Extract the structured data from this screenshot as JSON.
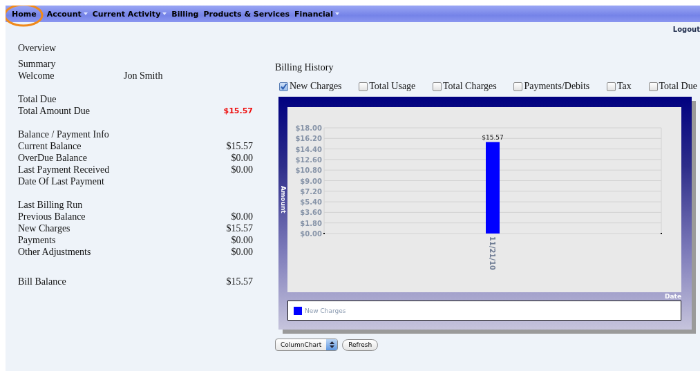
{
  "menu": [
    {
      "label": "Home",
      "has_dropdown": false,
      "highlighted": true
    },
    {
      "label": "Account",
      "has_dropdown": true,
      "highlighted": false
    },
    {
      "label": "Current Activity",
      "has_dropdown": true,
      "highlighted": false
    },
    {
      "label": "Billing",
      "has_dropdown": false,
      "highlighted": false
    },
    {
      "label": "Products & Services",
      "has_dropdown": false,
      "highlighted": false
    },
    {
      "label": "Financial",
      "has_dropdown": true,
      "highlighted": false
    }
  ],
  "logout": "Logout",
  "overview": {
    "title": "Overview",
    "sections": [
      {
        "title": "Summary",
        "rows": [
          {
            "label": "Welcome",
            "value": "Jon Smith",
            "kind": "name"
          }
        ]
      },
      {
        "title": "Total Due",
        "rows": [
          {
            "label": "Total Amount Due",
            "value": "$15.57",
            "kind": "alert"
          }
        ]
      },
      {
        "title": "Balance / Payment Info",
        "rows": [
          {
            "label": "Current Balance",
            "value": "$15.57",
            "kind": "amount"
          },
          {
            "label": "OverDue Balance",
            "value": "$0.00",
            "kind": "amount"
          },
          {
            "label": "Last Payment Received",
            "value": "$0.00",
            "kind": "amount"
          },
          {
            "label": "Date Of Last Payment"
          }
        ]
      },
      {
        "title": "Last Billing Run",
        "rows": [
          {
            "label": "Previous Balance",
            "value": "$0.00",
            "kind": "amount"
          },
          {
            "label": "New Charges",
            "value": "$15.57",
            "kind": "amount"
          },
          {
            "label": "Payments",
            "value": "$0.00",
            "kind": "amount"
          },
          {
            "label": "Other Adjustments",
            "value": "$0.00",
            "kind": "amount"
          }
        ]
      },
      {
        "rows": [
          {
            "label": "Bill Balance",
            "value": "$15.57",
            "kind": "amount"
          }
        ]
      }
    ]
  },
  "billing_history": {
    "title": "Billing History",
    "options": [
      {
        "label": "New Charges",
        "checked": true
      },
      {
        "label": "Total Usage",
        "checked": false
      },
      {
        "label": "Total Charges",
        "checked": false
      },
      {
        "label": "Payments/Debits",
        "checked": false
      },
      {
        "label": "Tax",
        "checked": false
      },
      {
        "label": "Total Due",
        "checked": false
      }
    ],
    "chart_data": {
      "type": "bar",
      "xlabel": "Date",
      "ylabel": "Amount",
      "categories": [
        "11/21/10"
      ],
      "series": [
        {
          "name": "New Charges",
          "color": "#0000ff",
          "values": [
            15.57
          ]
        }
      ],
      "ylim": [
        0,
        18
      ],
      "grid": true,
      "yticks": [
        {
          "value": 0,
          "label": "$0.00"
        },
        {
          "value": 1.8,
          "label": "$1.80"
        },
        {
          "value": 3.6,
          "label": "$3.60"
        },
        {
          "value": 5.4,
          "label": "$5.40"
        },
        {
          "value": 7.2,
          "label": "$7.20"
        },
        {
          "value": 9,
          "label": "$9.00"
        },
        {
          "value": 10.8,
          "label": "$10.80"
        },
        {
          "value": 12.6,
          "label": "$12.60"
        },
        {
          "value": 14.4,
          "label": "$14.40"
        },
        {
          "value": 16.2,
          "label": "$16.20"
        },
        {
          "value": 18,
          "label": "$18.00"
        }
      ],
      "value_labels": [
        "$15.57"
      ]
    },
    "chart_type": "ColumnChart",
    "refresh": "Refresh"
  }
}
